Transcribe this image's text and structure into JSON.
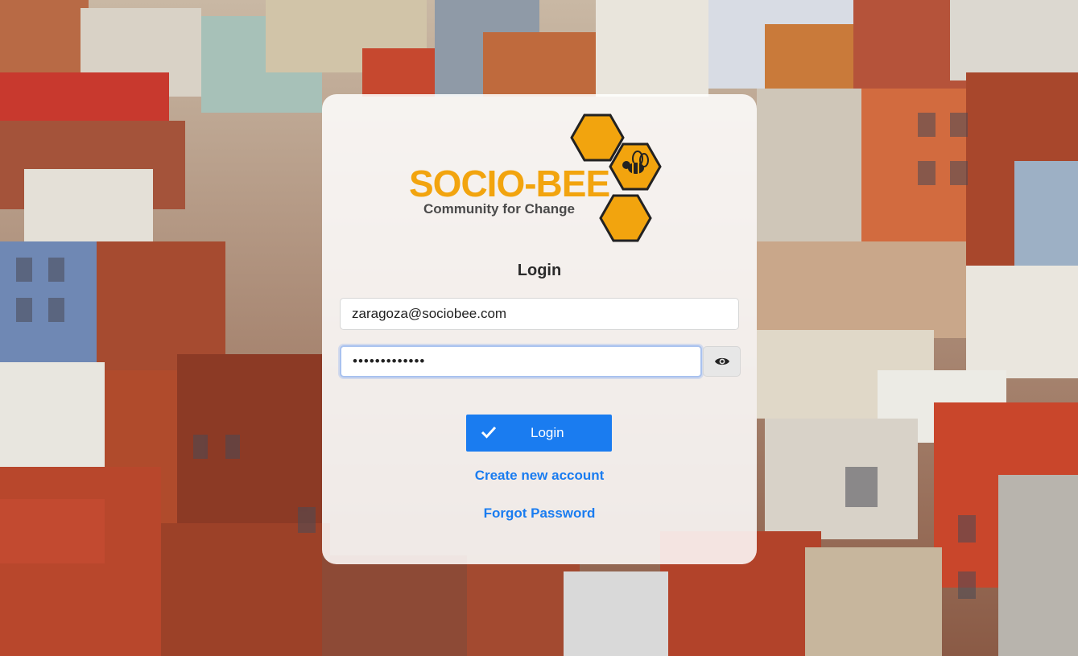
{
  "branding": {
    "title": "SOCIO-BEE",
    "subtitle": "Community for Change",
    "primary_color": "#f2a40e",
    "logo_icon": "bee-hexagon-icon"
  },
  "login_form": {
    "heading": "Login",
    "email_value": "zaragoza@sociobee.com",
    "password_value": "•••••••••••••",
    "toggle_icon": "eye-icon",
    "submit_label": "Login",
    "submit_icon": "check-icon",
    "accent_color": "#1a7cf0"
  },
  "links": {
    "create_account": "Create new account",
    "forgot_password": "Forgot Password"
  }
}
